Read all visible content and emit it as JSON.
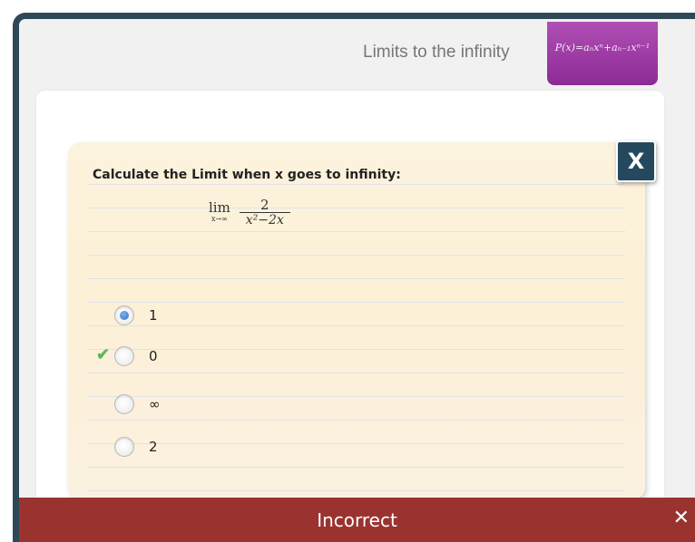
{
  "header": {
    "title": "Limits to the infinity",
    "formula_badge": "P(x)=aₙxⁿ+aₙ₋₁xⁿ⁻¹"
  },
  "exercise": {
    "close_label": "X",
    "question": "Calculate the Limit when x goes to infinity:",
    "math": {
      "lim_word": "lim",
      "lim_sub": "x→∞",
      "numerator": "2",
      "denominator": "x²−2x"
    },
    "options": [
      {
        "label": "1",
        "selected": true,
        "correct": false
      },
      {
        "label": "0",
        "selected": false,
        "correct": true
      },
      {
        "label": "∞",
        "selected": false,
        "correct": false
      },
      {
        "label": "2",
        "selected": false,
        "correct": false
      }
    ],
    "correct_mark": "✔"
  },
  "feedback": {
    "text": "Incorrect",
    "close_label": "✕",
    "color": "#9a3330"
  },
  "colors": {
    "frame_border": "#2f4858",
    "badge": "#a03fa7",
    "close_button": "#24485e",
    "radio_selected": "#2f6fc6",
    "check": "#5cb85c"
  }
}
